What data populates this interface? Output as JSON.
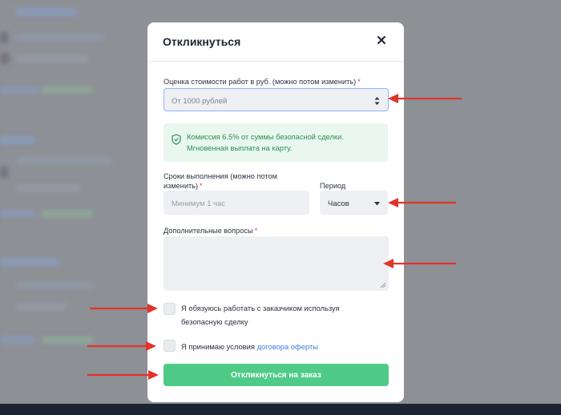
{
  "modal": {
    "title": "Откликнуться",
    "close_icon": "close-icon"
  },
  "price": {
    "label": "Оценка стоимости работ в руб. (можно потом изменить)",
    "required_mark": "*",
    "selected_value": "От 1000 рублей"
  },
  "notice": {
    "line1": "Комиссия 6.5% от суммы безопасной сделки.",
    "line2": "Мгновенная выплата на карту.",
    "icon": "shield-check-icon"
  },
  "deadline": {
    "label_line1": "Сроки выполнения (можно потом",
    "label_line2": "изменить)",
    "required_mark": "*",
    "placeholder": "Минимум 1 час"
  },
  "period": {
    "label": "Период",
    "selected_value": "Часов"
  },
  "questions": {
    "label": "Дополнительные вопросы",
    "required_mark": "*",
    "value": ""
  },
  "agreements": {
    "safe_deal_line1": "Я обязуюсь работать с заказчиком используя",
    "safe_deal_line2": "безопасную сделку",
    "offer_prefix": "Я принимаю условия",
    "offer_link": "договора оферты"
  },
  "submit": {
    "label": "Откликнуться на заказ"
  },
  "colors": {
    "accent_green": "#4fcb87",
    "notice_bg": "#e9f7ef",
    "notice_text": "#2e8c55",
    "required": "#e53935",
    "link": "#3f7fe0",
    "annotation_arrow": "#e0342c"
  }
}
